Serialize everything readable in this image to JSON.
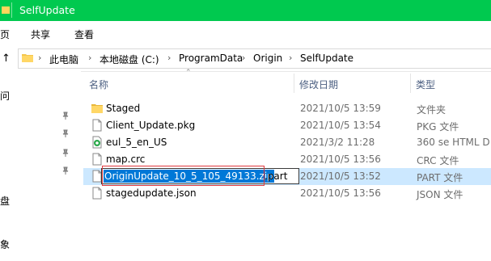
{
  "window": {
    "title": "SelfUpdate",
    "accent": "#00c94f"
  },
  "ribbon": {
    "tabs": [
      "页",
      "共享",
      "查看"
    ]
  },
  "address": {
    "crumbs": [
      "此电脑",
      "本地磁盘 (C:)",
      "ProgramData",
      "Origin",
      "SelfUpdate"
    ]
  },
  "navpane": {
    "labels": [
      "问",
      "盘",
      "象"
    ]
  },
  "columns": {
    "name": "名称",
    "date": "修改日期",
    "type": "类型"
  },
  "files": [
    {
      "name": "Staged",
      "date": "2021/10/5 13:59",
      "type": "文件夹",
      "icon": "folder-icon"
    },
    {
      "name": "Client_Update.pkg",
      "date": "2021/10/5 13:54",
      "type": "PKG 文件",
      "icon": "file-icon"
    },
    {
      "name": "eul_5_en_US",
      "date": "2021/3/2 11:28",
      "type": "360 se HTML D",
      "icon": "browser-html-icon"
    },
    {
      "name": "map.crc",
      "date": "2021/10/5 13:56",
      "type": "CRC 文件",
      "icon": "file-icon"
    },
    {
      "name": "OriginUpdate_10_5_105_49133.zip.part",
      "date": "2021/10/5 13:52",
      "type": "PART 文件",
      "icon": "file-icon"
    },
    {
      "name": "stagedupdate.json",
      "date": "2021/10/5 13:56",
      "type": "JSON 文件",
      "icon": "file-icon"
    }
  ],
  "rename": {
    "selected_text": "OriginUpdate_10_5_105_49133.zip",
    "rest_text": ".part"
  },
  "colors": {
    "selection": "#cce8ff",
    "text_selection": "#0078d7",
    "highlight_box": "#e0393e"
  }
}
